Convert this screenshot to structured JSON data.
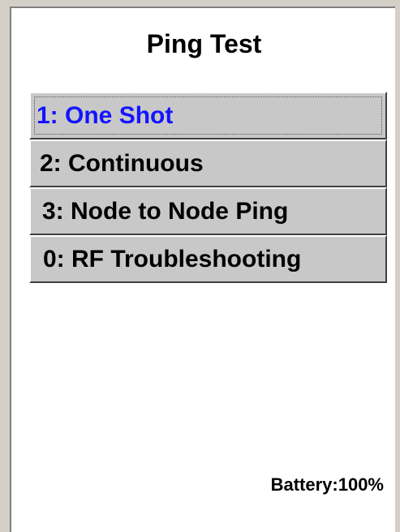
{
  "screen": {
    "title": "Ping Test"
  },
  "menu": {
    "selected_index": 0,
    "items": [
      {
        "label": "1: One Shot"
      },
      {
        "label": "2: Continuous"
      },
      {
        "label": "3: Node to Node Ping"
      },
      {
        "label": "0: RF Troubleshooting"
      }
    ]
  },
  "status": {
    "battery": "Battery:100%"
  },
  "colors": {
    "selected_text": "#1414ff",
    "button_face": "#c8c8c8",
    "screen_background": "#ffffff",
    "window_background": "#d4d0c8"
  }
}
